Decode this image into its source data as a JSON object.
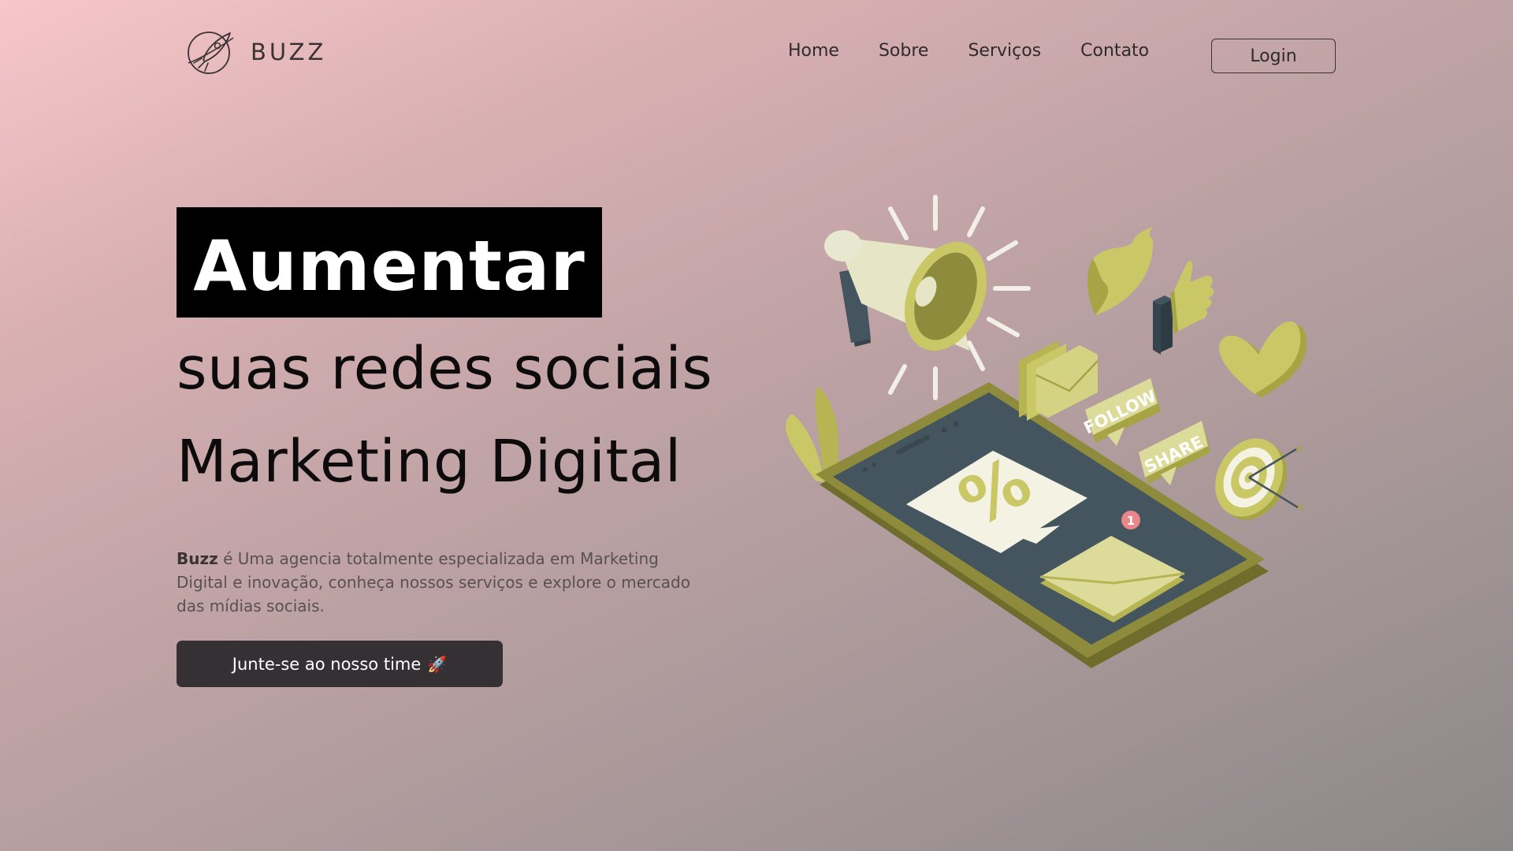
{
  "navbar": {
    "brand": "BUZZ",
    "links": [
      "Home",
      "Sobre",
      "Serviços",
      "Contato"
    ],
    "login_label": "Login"
  },
  "hero": {
    "highlight": "Aumentar",
    "line2": "suas redes sociais",
    "line3": "Marketing Digital",
    "description_brand": "Buzz",
    "description_rest": " é Uma agencia totalmente especializada em Marketing Digital e inovação, conheça nossos serviços e explore o mercado das mídias sociais.",
    "cta_label": "Junte-se ao nosso time",
    "cta_emoji": "🚀"
  },
  "illustration": {
    "follow_label": "FOLLOW",
    "share_label": "SHARE",
    "percent_symbol": "%",
    "notification_count": "1"
  },
  "colors": {
    "accent_olive": "#c9c766",
    "olive_dark": "#8e8b3c",
    "screen_slate": "#44555f",
    "button_dark": "#353034"
  },
  "icons": [
    "rocket-logo-icon",
    "megaphone-icon",
    "twitter-bird-icon",
    "thumbs-up-icon",
    "heart-icon",
    "envelope-icon",
    "target-icon",
    "rocket-emoji"
  ]
}
